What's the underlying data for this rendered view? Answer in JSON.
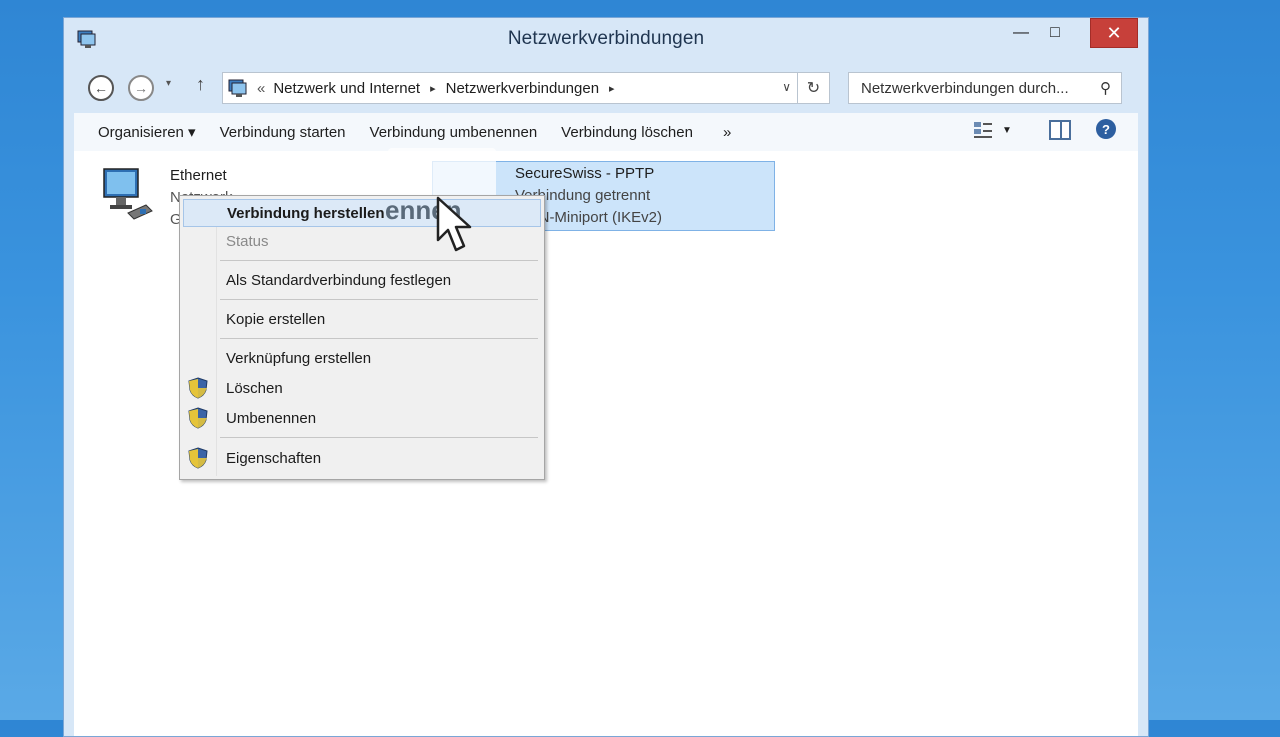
{
  "window": {
    "title": "Netzwerkverbindungen",
    "minimize": "—",
    "maximize": "□",
    "close": "✕"
  },
  "navigation": {
    "back": "←",
    "forward": "→",
    "recent": "▾",
    "up": "↑",
    "address_prefix": "«",
    "breadcrumb": [
      "Netzwerk und Internet",
      "Netzwerkverbindungen"
    ],
    "refresh": "↻",
    "search_placeholder": "Netzwerkverbindungen durch...",
    "search_icon": "⌕"
  },
  "toolbar": {
    "items": [
      "Organisieren ▾",
      "Verbindung starten",
      "Verbindung umbenennen",
      "Verbindung löschen"
    ],
    "more": "»",
    "help": "?"
  },
  "connections": {
    "ethernet": {
      "name": "Ethernet",
      "line1": "Netzwerk",
      "line2": "G"
    },
    "vpn": {
      "name": "SecureSwiss - PPTP",
      "status": "Verbindung getrennt",
      "device": "WAN-Miniport (IKEv2)"
    }
  },
  "context_menu": {
    "items": [
      {
        "label": "Verbindung herstellen",
        "state": "active"
      },
      {
        "label": "Status",
        "state": "disabled"
      },
      {
        "label": "Als Standardverbindung festlegen",
        "state": "normal"
      },
      {
        "label": "Kopie erstellen",
        "state": "normal"
      },
      {
        "label": "Verknüpfung erstellen",
        "state": "normal"
      },
      {
        "label": "Löschen",
        "state": "normal",
        "shield": true
      },
      {
        "label": "Umbenennen",
        "state": "normal",
        "shield": true
      },
      {
        "label": "Eigenschaften",
        "state": "normal",
        "shield": true
      }
    ]
  },
  "overlay": {
    "drag_text": "ennen"
  },
  "colors": {
    "desktop": "#3a93de",
    "selection": "#cce4fa",
    "close_button": "#c7403a"
  }
}
